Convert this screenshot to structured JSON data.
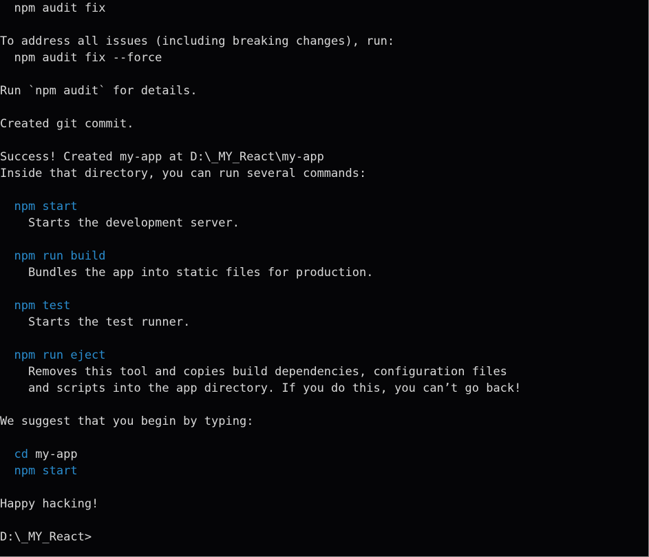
{
  "lines": {
    "l1": "npm audit fix",
    "l2": "",
    "l3": "To address all issues (including breaking changes), run:",
    "l4": "npm audit fix --force",
    "l5": "",
    "l6": "Run `npm audit` for details.",
    "l7": "",
    "l8": "Created git commit.",
    "l9": "",
    "l10a": "Success! Created ",
    "l10b": "my-app ",
    "l10c": "at ",
    "l10d": "D:\\_MY_React\\my-app",
    "l11": "Inside that directory, you can run several commands:",
    "l12": "",
    "l13": "npm start",
    "l14": "Starts the development server.",
    "l15": "",
    "l16": "npm run build",
    "l17": "Bundles the app into static files for production.",
    "l18": "",
    "l19": "npm test",
    "l20": "Starts the test runner.",
    "l21": "",
    "l22": "npm run eject",
    "l23": "Removes this tool and copies build dependencies, configuration files",
    "l24": "and scripts into the app directory. If you do this, you can’t go back!",
    "l25": "",
    "l26": "We suggest that you begin by typing:",
    "l27": "",
    "l28a": "cd ",
    "l28b": "my-app",
    "l29": "npm start",
    "l30": "",
    "l31": "Happy hacking!",
    "l32": "",
    "prompt": "D:\\_MY_React>"
  }
}
